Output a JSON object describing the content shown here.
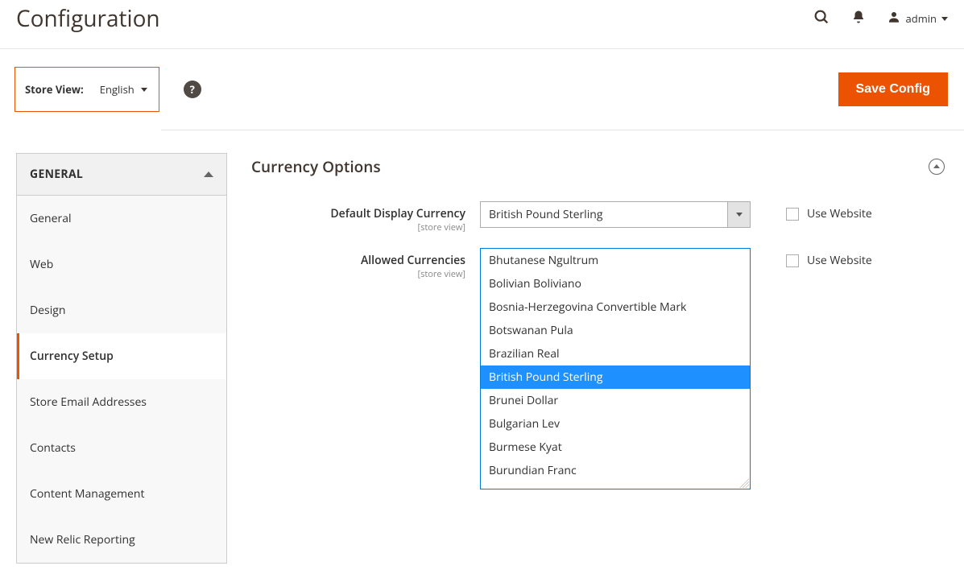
{
  "header": {
    "title": "Configuration",
    "user_label": "admin"
  },
  "toolbar": {
    "store_view_label": "Store View:",
    "store_view_value": "English",
    "save_label": "Save Config"
  },
  "sidebar": {
    "section_label": "GENERAL",
    "items": [
      {
        "label": "General",
        "active": false
      },
      {
        "label": "Web",
        "active": false
      },
      {
        "label": "Design",
        "active": false
      },
      {
        "label": "Currency Setup",
        "active": true
      },
      {
        "label": "Store Email Addresses",
        "active": false
      },
      {
        "label": "Contacts",
        "active": false
      },
      {
        "label": "Content Management",
        "active": false
      },
      {
        "label": "New Relic Reporting",
        "active": false
      }
    ]
  },
  "section": {
    "title": "Currency Options"
  },
  "fields": {
    "default_display_currency": {
      "label": "Default Display Currency",
      "scope": "[store view]",
      "value": "British Pound Sterling",
      "use_website_label": "Use Website",
      "use_website_checked": false
    },
    "allowed_currencies": {
      "label": "Allowed Currencies",
      "scope": "[store view]",
      "use_website_label": "Use Website",
      "use_website_checked": false,
      "options": [
        {
          "label": "Bhutanese Ngultrum",
          "selected": false
        },
        {
          "label": "Bolivian Boliviano",
          "selected": false
        },
        {
          "label": "Bosnia-Herzegovina Convertible Mark",
          "selected": false
        },
        {
          "label": "Botswanan Pula",
          "selected": false
        },
        {
          "label": "Brazilian Real",
          "selected": false
        },
        {
          "label": "British Pound Sterling",
          "selected": true
        },
        {
          "label": "Brunei Dollar",
          "selected": false
        },
        {
          "label": "Bulgarian Lev",
          "selected": false
        },
        {
          "label": "Burmese Kyat",
          "selected": false
        },
        {
          "label": "Burundian Franc",
          "selected": false
        }
      ]
    }
  }
}
